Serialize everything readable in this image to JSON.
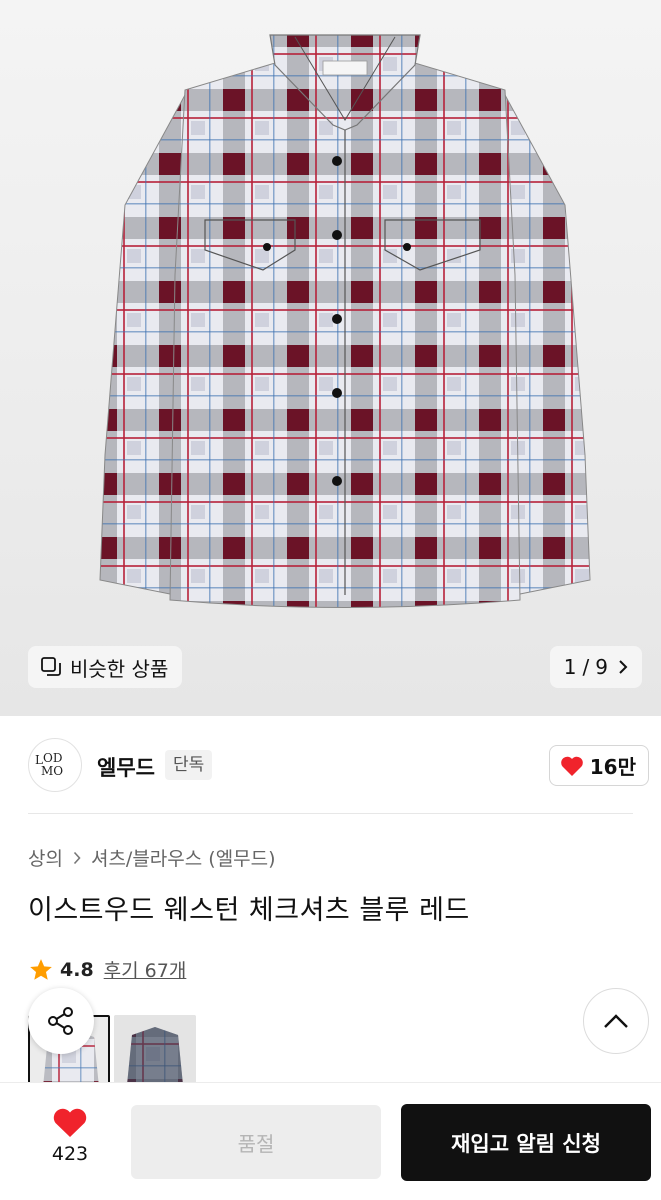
{
  "gallery": {
    "similar_label": "비슷한 상품",
    "current_page": "1",
    "separator": "/",
    "total_pages": "9"
  },
  "brand": {
    "logo_text": "LMOOD",
    "name": "엘무드",
    "badge": "단독"
  },
  "likes": {
    "label": "16만"
  },
  "breadcrumb": {
    "level1": "상의",
    "level2": "셔츠/블라우스 (엘무드)"
  },
  "product": {
    "title": "이스트우드 웨스턴 체크셔츠 블루 레드"
  },
  "rating": {
    "score": "4.8",
    "reviews": "후기 67개"
  },
  "bottom_bar": {
    "wish_count": "423",
    "soldout_label": "품절",
    "restock_label": "재입고 알림 신청"
  },
  "colors": {
    "heart": "#f0232c",
    "star": "#ff9d00",
    "primary_button": "#111111",
    "disabled_button": "#ededed"
  },
  "icons": [
    "similar-products-icon",
    "chevron-right-icon",
    "heart-icon",
    "star-icon",
    "share-icon",
    "chevron-up-icon"
  ]
}
